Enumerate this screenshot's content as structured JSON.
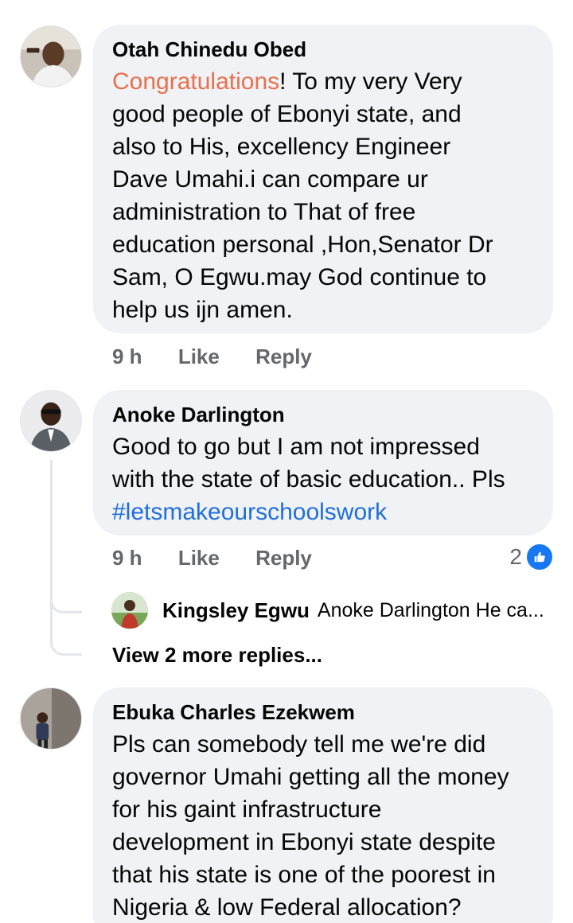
{
  "comments": [
    {
      "author": "Otah Chinedu Obed",
      "text_highlight": "Congratulations",
      "text_rest_line1": "! To my very  Very",
      "lines": [
        "good people  of Ebonyi state, and",
        "also to  His,  excellency Engineer",
        "Dave Umahi.i can compare ur",
        "administration to That of  free",
        "education personal ,Hon,Senator Dr",
        "Sam, O Egwu.may God continue to",
        "help us ijn amen."
      ],
      "time": "9 h",
      "like_label": "Like",
      "reply_label": "Reply"
    },
    {
      "author": "Anoke Darlington",
      "lines": [
        "Good to go but I am not impressed",
        "with the state of basic education.. Pls"
      ],
      "hashtag": "#letsmakeourschoolswork",
      "time": "9 h",
      "like_label": "Like",
      "reply_label": "Reply",
      "reaction_count": "2",
      "reply_preview": {
        "author": "Kingsley Egwu",
        "snippet": "Anoke Darlington He ca..."
      },
      "view_more": "View 2 more replies..."
    },
    {
      "author": "Ebuka Charles Ezekwem",
      "lines": [
        "Pls can somebody tell me we're did",
        "governor Umahi getting all the money",
        "for his gaint infrastructure",
        "development in Ebonyi state despite",
        "that his state is one of the poorest in",
        "Nigeria & low Federal allocation?"
      ]
    }
  ],
  "colors": {
    "bubble": "#f0f2f5",
    "highlight": "#e9704e",
    "hashtag": "#216fdb",
    "meta": "#65676b",
    "like_badge": "#1877f2"
  }
}
